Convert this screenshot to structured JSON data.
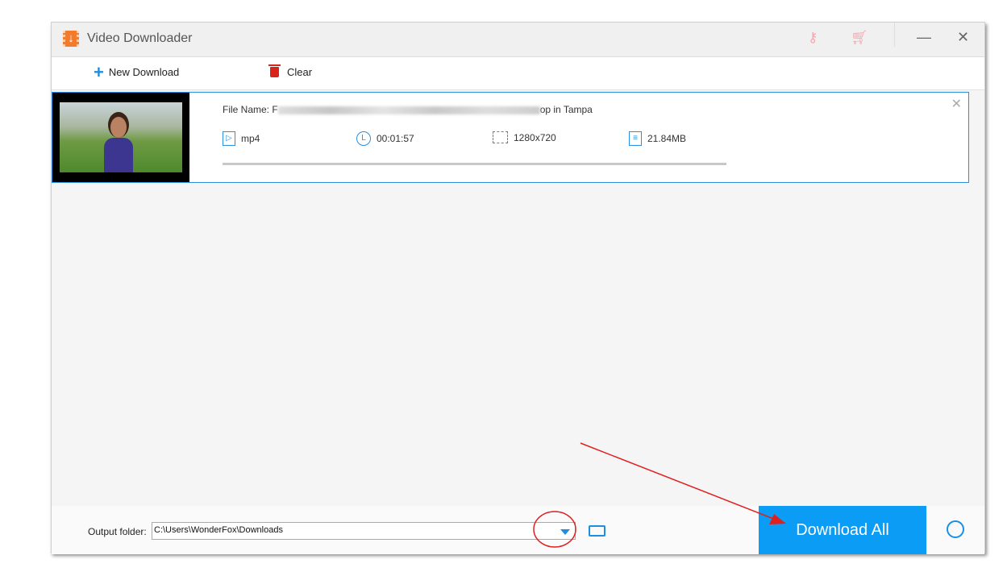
{
  "window": {
    "title": "Video Downloader",
    "icons": [
      "key-icon",
      "cart-icon",
      "minimize-icon",
      "close-icon"
    ]
  },
  "toolbar": {
    "new_download": "New Download",
    "clear": "Clear"
  },
  "item": {
    "file_name_label": "File Name:",
    "file_name_start": "F",
    "file_name_end": "op in Tampa",
    "format": "mp4",
    "duration": "00:01:57",
    "resolution": "1280x720",
    "size": "21.84MB",
    "progress": 0
  },
  "bottom": {
    "output_label": "Output folder:",
    "output_path": "C:\\Users\\WonderFox\\Downloads",
    "download_all": "Download All"
  },
  "colors": {
    "accent": "#0b9cf5",
    "annotation": "#e02020"
  }
}
